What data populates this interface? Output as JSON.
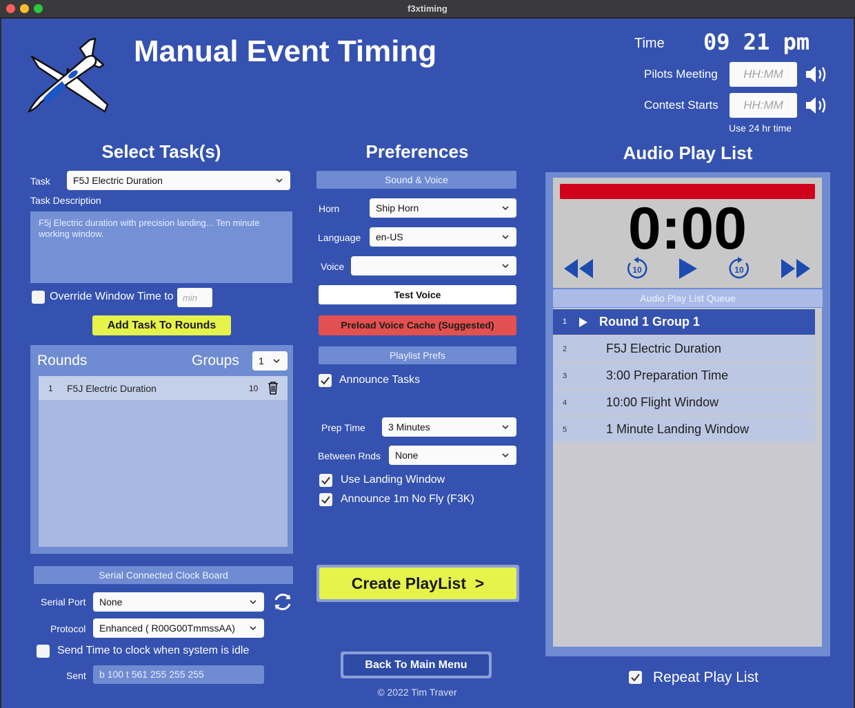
{
  "window": {
    "title": "f3xtiming"
  },
  "header": {
    "title": "Manual Event Timing",
    "time_label": "Time",
    "time_value": "09 21 pm",
    "pilots_meeting_label": "Pilots Meeting",
    "pilots_meeting_placeholder": "HH:MM",
    "contest_starts_label": "Contest Starts",
    "contest_starts_placeholder": "HH:MM",
    "hint_24hr": "Use 24 hr time"
  },
  "tasks": {
    "section_title": "Select Task(s)",
    "task_label": "Task",
    "task_selected": "F5J Electric Duration",
    "description_label": "Task Description",
    "description_text": "F5j Electric duration with precision landing... Ten minute working window.",
    "override_label": "Override Window Time to",
    "override_placeholder": "min",
    "add_button": "Add Task To Rounds",
    "rounds_label": "Rounds",
    "groups_label": "Groups",
    "groups_value": "1",
    "rounds": [
      {
        "num": "1",
        "name": "F5J Electric Duration",
        "minutes": "10"
      }
    ]
  },
  "serial": {
    "section_label": "Serial Connected Clock Board",
    "port_label": "Serial Port",
    "port_value": "None",
    "protocol_label": "Protocol",
    "protocol_value": "Enhanced ( R00G00TmmssAA)",
    "idle_label": "Send Time to clock when system is idle",
    "sent_label": "Sent",
    "sent_value": "b 100 t 561 255 255 255"
  },
  "prefs": {
    "section_title": "Preferences",
    "sound_voice_label": "Sound & Voice",
    "horn_label": "Horn",
    "horn_value": "Ship Horn",
    "language_label": "Language",
    "language_value": "en-US",
    "voice_label": "Voice",
    "voice_value": "",
    "test_voice_button": "Test Voice",
    "preload_button": "Preload Voice Cache (Suggested)",
    "playlist_prefs_label": "Playlist Prefs",
    "announce_tasks_label": "Announce Tasks",
    "prep_time_label": "Prep Time",
    "prep_time_value": "3 Minutes",
    "between_rnds_label": "Between Rnds",
    "between_rnds_value": "None",
    "use_landing_label": "Use Landing Window",
    "announce_no_fly_label": "Announce 1m No Fly (F3K)",
    "create_button": "Create PlayList  >",
    "back_button": "Back To Main Menu",
    "copyright": "© 2022 Tim Traver"
  },
  "audio": {
    "section_title": "Audio Play List",
    "timer": "0:00",
    "queue_label": "Audio Play List Queue",
    "queue": [
      {
        "num": "1",
        "label": "Round 1 Group 1"
      },
      {
        "num": "2",
        "label": "F5J Electric Duration"
      },
      {
        "num": "3",
        "label": "3:00 Preparation Time"
      },
      {
        "num": "4",
        "label": "10:00 Flight Window"
      },
      {
        "num": "5",
        "label": "1 Minute Landing Window"
      }
    ],
    "repeat_label": "Repeat Play List"
  },
  "colors": {
    "background": "#3552b0",
    "accent_yellow": "#e5f34b",
    "accent_red": "#e35050",
    "progress_red": "#d0021b",
    "queue_active": "#3552b0"
  },
  "icons": [
    "plane-logo-icon",
    "speaker-icon",
    "chevron-down-icon",
    "trash-icon",
    "refresh-icon",
    "rewind-icon",
    "replay-10-icon",
    "play-icon",
    "forward-10-icon",
    "fast-forward-icon",
    "checkmark-icon"
  ]
}
